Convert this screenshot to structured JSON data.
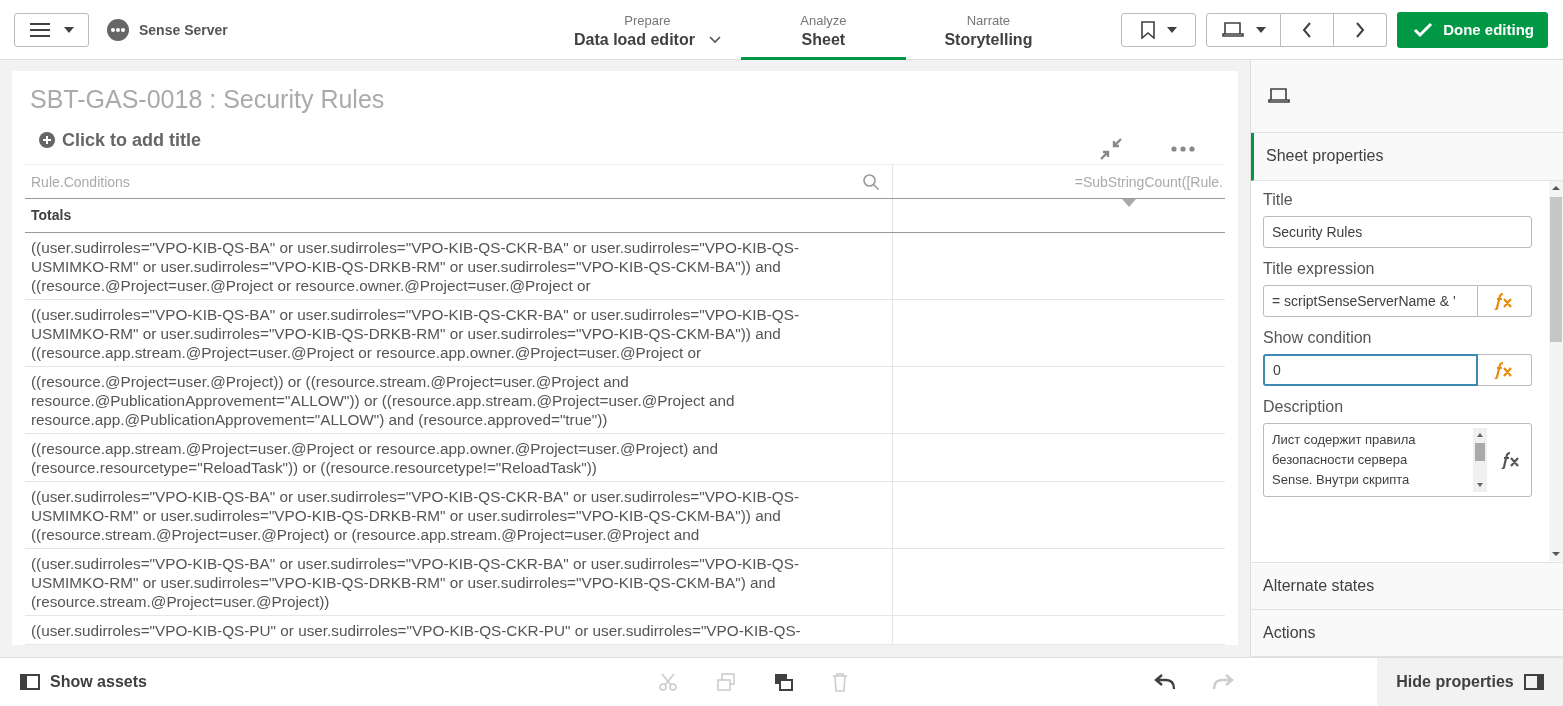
{
  "app": {
    "name": "Sense Server"
  },
  "nav_tabs": [
    {
      "caption": "Prepare",
      "label": "Data load editor",
      "selected": false,
      "has_dropdown": true
    },
    {
      "caption": "Analyze",
      "label": "Sheet",
      "selected": true,
      "has_dropdown": false
    },
    {
      "caption": "Narrate",
      "label": "Storytelling",
      "selected": false,
      "has_dropdown": false
    }
  ],
  "done_button": "Done editing",
  "sheet": {
    "title": "SBT-GAS-0018 : Security Rules",
    "add_title": "Click to add title"
  },
  "table": {
    "columns": [
      {
        "header": "Rule.Conditions"
      },
      {
        "header": "=SubStringCount([Rule."
      }
    ],
    "totals_label": "Totals",
    "rows": [
      "((user.sudirroles=\"VPO-KIB-QS-BA\" or user.sudirroles=\"VPO-KIB-QS-CKR-BA\" or user.sudirroles=\"VPO-KIB-QS-\nUSMIMKO-RM\" or user.sudirroles=\"VPO-KIB-QS-DRKB-RM\" or user.sudirroles=\"VPO-KIB-QS-CKM-BA\")) and\n((resource.@Project=user.@Project or resource.owner.@Project=user.@Project or",
      "((user.sudirroles=\"VPO-KIB-QS-BA\" or user.sudirroles=\"VPO-KIB-QS-CKR-BA\" or user.sudirroles=\"VPO-KIB-QS-\nUSMIMKO-RM\" or user.sudirroles=\"VPO-KIB-QS-DRKB-RM\" or user.sudirroles=\"VPO-KIB-QS-CKM-BA\")) and\n((resource.app.stream.@Project=user.@Project or resource.app.owner.@Project=user.@Project or",
      "((resource.@Project=user.@Project)) or ((resource.stream.@Project=user.@Project and\nresource.@PublicationApprovement=\"ALLOW\")) or ((resource.app.stream.@Project=user.@Project and\nresource.app.@PublicationApprovement=\"ALLOW\") and (resource.approved=\"true\"))",
      "((resource.app.stream.@Project=user.@Project or resource.app.owner.@Project=user.@Project) and\n(resource.resourcetype=\"ReloadTask\")) or ((resource.resourcetype!=\"ReloadTask\"))",
      "((user.sudirroles=\"VPO-KIB-QS-BA\" or user.sudirroles=\"VPO-KIB-QS-CKR-BA\" or user.sudirroles=\"VPO-KIB-QS-\nUSMIMKO-RM\" or user.sudirroles=\"VPO-KIB-QS-DRKB-RM\" or user.sudirroles=\"VPO-KIB-QS-CKM-BA\")) and\n((resource.stream.@Project=user.@Project) or (resource.app.stream.@Project=user.@Project and",
      "((user.sudirroles=\"VPO-KIB-QS-BA\" or user.sudirroles=\"VPO-KIB-QS-CKR-BA\" or user.sudirroles=\"VPO-KIB-QS-\nUSMIMKO-RM\" or user.sudirroles=\"VPO-KIB-QS-DRKB-RM\" or user.sudirroles=\"VPO-KIB-QS-CKM-BA\") and\n(resource.stream.@Project=user.@Project))",
      "((user.sudirroles=\"VPO-KIB-QS-PU\" or user.sudirroles=\"VPO-KIB-QS-CKR-PU\" or user.sudirroles=\"VPO-KIB-QS-"
    ]
  },
  "properties": {
    "section": "Sheet properties",
    "fields": [
      {
        "kind": "text",
        "label": "Title",
        "value": "Security Rules",
        "focused": false
      },
      {
        "kind": "expression",
        "label": "Title expression",
        "value": "= scriptSenseServerName & '",
        "focused": false
      },
      {
        "kind": "expression",
        "label": "Show condition",
        "value": "0",
        "focused": true
      },
      {
        "kind": "textarea",
        "label": "Description",
        "value": "Лист содержит правила\nбезопасности сервера\nSense. Внутри скрипта",
        "focused": false
      }
    ],
    "collapsed_sections": [
      "Alternate states",
      "Actions"
    ]
  },
  "footer": {
    "show_assets": "Show assets",
    "hide_properties": "Hide properties"
  }
}
